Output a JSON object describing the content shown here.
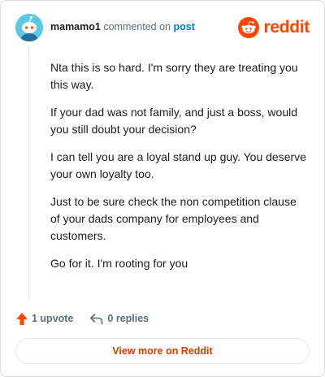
{
  "header": {
    "username": "mamamo1",
    "action_text": "commented on",
    "post_link": "post"
  },
  "brand": {
    "logo_icon": "reddit-snoo-icon",
    "name": "reddit",
    "color": "#ff4500"
  },
  "comment": {
    "paragraphs": [
      "Nta this is so hard. I'm sorry they are treating you this way.",
      "If your dad was not family, and just a boss, would you still doubt your decision?",
      "I can tell you are a loyal stand up guy. You deserve your own loyalty too.",
      "Just to be sure check the non competition clause of your dads company for employees and customers.",
      "Go for it. I'm rooting for you"
    ]
  },
  "footer": {
    "upvote_icon": "upvote-arrow-icon",
    "upvote_label": "1 upvote",
    "reply_icon": "reply-arrow-icon",
    "replies_label": "0 replies"
  },
  "view_more_label": "View more on Reddit",
  "colors": {
    "accent": "#ff4500",
    "link": "#0079d3",
    "view_more": "#d93a00"
  }
}
